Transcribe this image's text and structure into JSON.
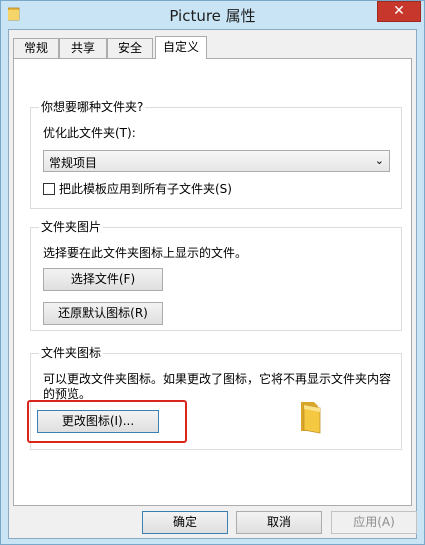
{
  "window": {
    "title": "Picture 属性",
    "close_label": "✕"
  },
  "tabs": [
    {
      "label": "常规",
      "active": false
    },
    {
      "label": "共享",
      "active": false
    },
    {
      "label": "安全",
      "active": false
    },
    {
      "label": "自定义",
      "active": true
    }
  ],
  "optimize_group": {
    "title": "你想要哪种文件夹?",
    "optimize_label": "优化此文件夹(T):",
    "optimize_value": "常规项目",
    "apply_subfolders_label": "把此模板应用到所有子文件夹(S)",
    "apply_subfolders_checked": false
  },
  "picture_group": {
    "title": "文件夹图片",
    "description": "选择要在此文件夹图标上显示的文件。",
    "choose_file_label": "选择文件(F)",
    "restore_default_label": "还原默认图标(R)"
  },
  "icon_group": {
    "title": "文件夹图标",
    "description_line1": "可以更改文件夹图标。如果更改了图标，它将不再显示文件夹内容",
    "description_line2": "的预览。",
    "change_icon_label": "更改图标(I)..."
  },
  "footer": {
    "ok_label": "确定",
    "cancel_label": "取消",
    "apply_label": "应用(A)"
  },
  "colors": {
    "titlebar_bg": "#c9e5f5",
    "close_button": "#c7372b",
    "highlight": "#d9261c",
    "folder_yellow": "#f5c842"
  }
}
